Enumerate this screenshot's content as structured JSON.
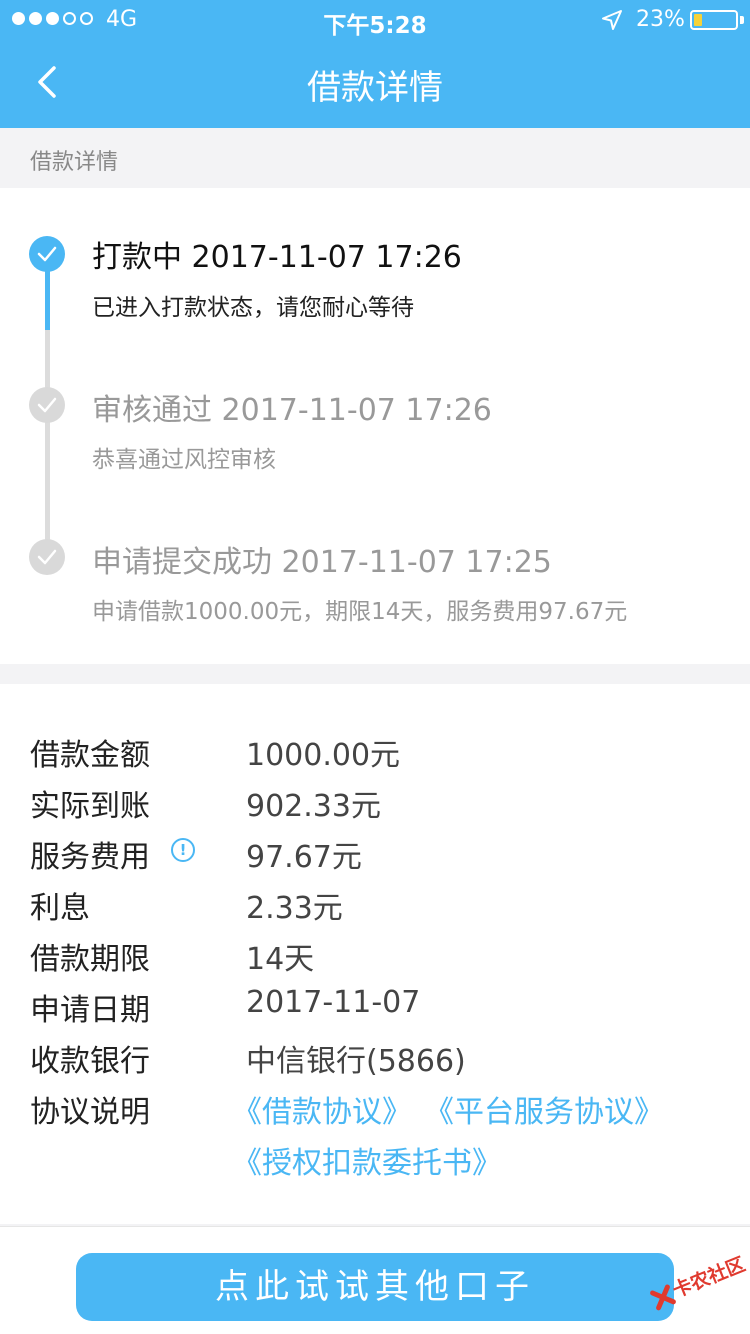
{
  "status_bar": {
    "carrier": "4G",
    "time": "下午5:28",
    "battery": "23%"
  },
  "nav": {
    "title": "借款详情"
  },
  "section_label": "借款详情",
  "timeline": [
    {
      "title": "打款中 2017-11-07 17:26",
      "desc": "已进入打款状态，请您耐心等待"
    },
    {
      "title": "审核通过 2017-11-07 17:26",
      "desc": "恭喜通过风控审核"
    },
    {
      "title": "申请提交成功 2017-11-07 17:25",
      "desc": "申请借款1000.00元，期限14天，服务费用97.67元"
    }
  ],
  "details": {
    "rows": [
      {
        "label": "借款金额",
        "value": "1000.00元"
      },
      {
        "label": "实际到账",
        "value": "902.33元"
      },
      {
        "label": "服务费用",
        "value": "97.67元"
      },
      {
        "label": "利息",
        "value": "2.33元"
      },
      {
        "label": "借款期限",
        "value": "14天"
      },
      {
        "label": "申请日期",
        "value": "2017-11-07"
      },
      {
        "label": "收款银行",
        "value": "中信银行(5866)"
      },
      {
        "label": "协议说明",
        "value": ""
      }
    ],
    "links": [
      "《借款协议》",
      "《平台服务协议》",
      "《授权扣款委托书》"
    ]
  },
  "cta_label": "点此试试其他口子",
  "watermark": "卡农社区",
  "colors": {
    "accent": "#4ab7f4",
    "inactive": "#d9d9d9",
    "background": "#f3f3f5",
    "watermark": "#e03a2f"
  },
  "icons": [
    "back-chevron-icon",
    "location-arrow-icon",
    "battery-icon",
    "check-icon",
    "info-icon"
  ]
}
